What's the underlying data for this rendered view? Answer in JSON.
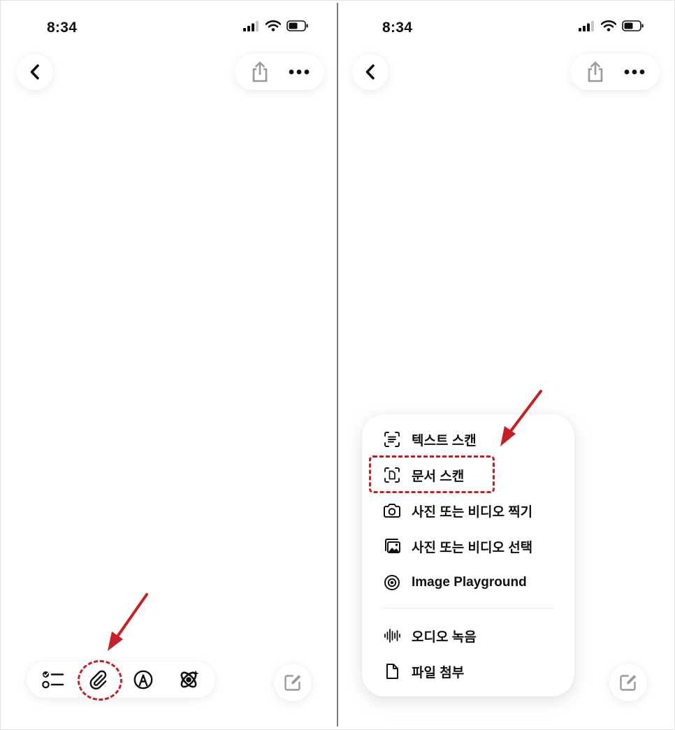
{
  "left_screen": {
    "status_bar": {
      "time": "8:34"
    },
    "top_bar": {
      "back": "chevron-left-icon",
      "share": "share-icon",
      "more": "ellipsis-icon"
    },
    "bottom_toolbar": {
      "items": [
        "checklist-icon",
        "paperclip-icon",
        "markup-pen-icon",
        "apple-intelligence-icon"
      ],
      "compose": "compose-icon"
    }
  },
  "right_screen": {
    "status_bar": {
      "time": "8:34"
    },
    "attach_menu": {
      "items": [
        {
          "label": "텍스트 스캔",
          "icon": "scan-text-icon"
        },
        {
          "label": "문서 스캔",
          "icon": "scan-document-icon"
        },
        {
          "label": "사진 또는 비디오 찍기",
          "icon": "camera-icon"
        },
        {
          "label": "사진 또는 비디오 선택",
          "icon": "photo-library-icon"
        },
        {
          "label": "Image Playground",
          "icon": "image-playground-icon"
        },
        {
          "label": "오디오 녹음",
          "icon": "waveform-icon"
        },
        {
          "label": "파일 첨부",
          "icon": "document-icon"
        }
      ]
    }
  },
  "colors": {
    "annotation": "#c71f26",
    "divider": "#7d7d7d",
    "icon_gray": "#9a9a9a",
    "text": "#111111"
  }
}
